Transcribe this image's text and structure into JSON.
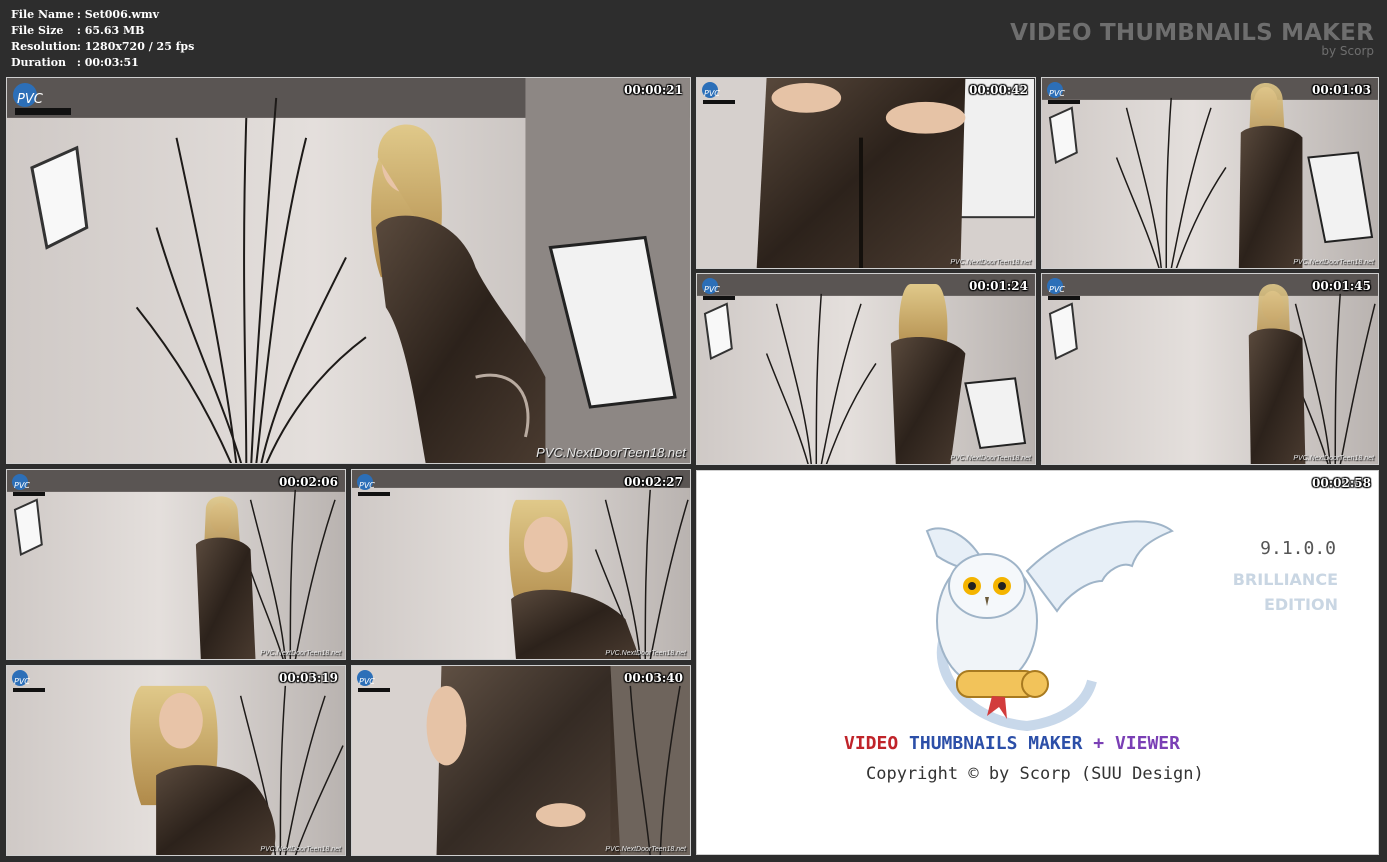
{
  "info": {
    "file_name_label": "File Name",
    "file_name": ": Set006.wmv",
    "file_size_label": "File Size",
    "file_size": ": 65.63 MB",
    "resolution_label": "Resolution",
    "resolution": ": 1280x720 / 25 fps",
    "duration_label": "Duration",
    "duration": ": 00:03:51"
  },
  "brand": {
    "title": "VIDEO THUMBNAILS MAKER",
    "subtitle": "by Scorp"
  },
  "thumbs": [
    {
      "time": "00:00:21",
      "watermark": "PVC.NextDoorTeen18.net"
    },
    {
      "time": "00:00:42",
      "watermark": "PVC.NextDoorTeen18.net"
    },
    {
      "time": "00:01:03",
      "watermark": "PVC.NextDoorTeen18.net"
    },
    {
      "time": "00:01:24",
      "watermark": "PVC.NextDoorTeen18.net"
    },
    {
      "time": "00:01:45",
      "watermark": "PVC.NextDoorTeen18.net"
    },
    {
      "time": "00:02:06",
      "watermark": "PVC.NextDoorTeen18.net"
    },
    {
      "time": "00:02:27",
      "watermark": "PVC.NextDoorTeen18.net"
    },
    {
      "time": "00:03:19",
      "watermark": "PVC.NextDoorTeen18.net"
    },
    {
      "time": "00:03:40",
      "watermark": "PVC.NextDoorTeen18.net"
    }
  ],
  "about": {
    "time": "00:02:58",
    "version": "9.1.0.0",
    "edition_line1": "BRILLIANCE",
    "edition_line2": "EDITION",
    "name_part1": "VIDEO",
    "name_part2": "THUMBNAILS MAKER",
    "name_part3": "+ VIEWER",
    "copyright": "Copyright © by Scorp (SUU Design)"
  },
  "colors": {
    "background": "#2d2d2d",
    "brand_gray": "#6e6e6e",
    "wall": "#d9d4d2",
    "pvc": "#3a2e24"
  },
  "icons": {
    "logo": "pvc-logo-icon",
    "owl": "owl-mascot-icon"
  }
}
